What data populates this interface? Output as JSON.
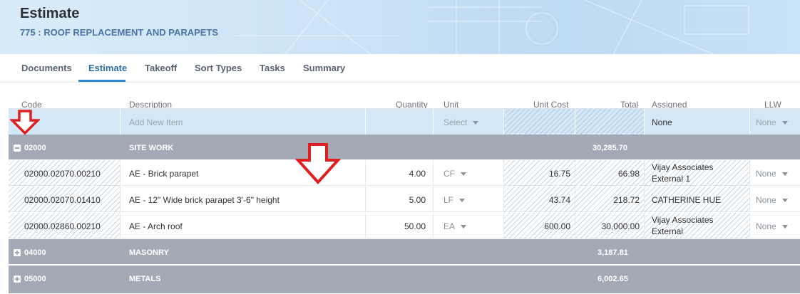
{
  "header": {
    "title": "Estimate",
    "subtitle": "775 : ROOF REPLACEMENT AND PARAPETS"
  },
  "tabs": [
    {
      "label": "Documents"
    },
    {
      "label": "Estimate",
      "active": true
    },
    {
      "label": "Takeoff"
    },
    {
      "label": "Sort Types"
    },
    {
      "label": "Tasks"
    },
    {
      "label": "Summary"
    }
  ],
  "columns": {
    "code": "Code",
    "description": "Description",
    "quantity": "Quantity",
    "unit": "Unit",
    "unit_cost": "Unit Cost",
    "total": "Total",
    "assigned": "Assigned",
    "llw": "LLW"
  },
  "add_row": {
    "placeholder": "Add New Item",
    "unit": "Select",
    "assigned": "None",
    "llw": "None"
  },
  "groups": [
    {
      "code": "02000",
      "name": "SITE WORK",
      "total": "30,285.70",
      "expanded": true,
      "items": [
        {
          "code": "02000.02070.00210",
          "description": "AE - Brick parapet",
          "quantity": "4.00",
          "unit": "CF",
          "unit_cost": "16.75",
          "total": "66.98",
          "assigned_1": "Vijay Associates",
          "assigned_2": "External 1",
          "llw": "None"
        },
        {
          "code": "02000.02070.01410",
          "description": "AE - 12\" Wide brick parapet 3'-6\" height",
          "quantity": "5.00",
          "unit": "LF",
          "unit_cost": "43.74",
          "total": "218.72",
          "assigned_1": "CATHERINE HUE",
          "assigned_2": "",
          "llw": "None"
        },
        {
          "code": "02000.02860.00210",
          "description": "AE - Arch roof",
          "quantity": "50.00",
          "unit": "EA",
          "unit_cost": "600.00",
          "total": "30,000.00",
          "assigned_1": "Vijay Associates",
          "assigned_2": "External",
          "llw": "None"
        }
      ]
    },
    {
      "code": "04000",
      "name": "MASONRY",
      "total": "3,187.81",
      "expanded": false
    },
    {
      "code": "05000",
      "name": "METALS",
      "total": "6,002.65",
      "expanded": false
    }
  ],
  "annotation_color": "#e02020"
}
